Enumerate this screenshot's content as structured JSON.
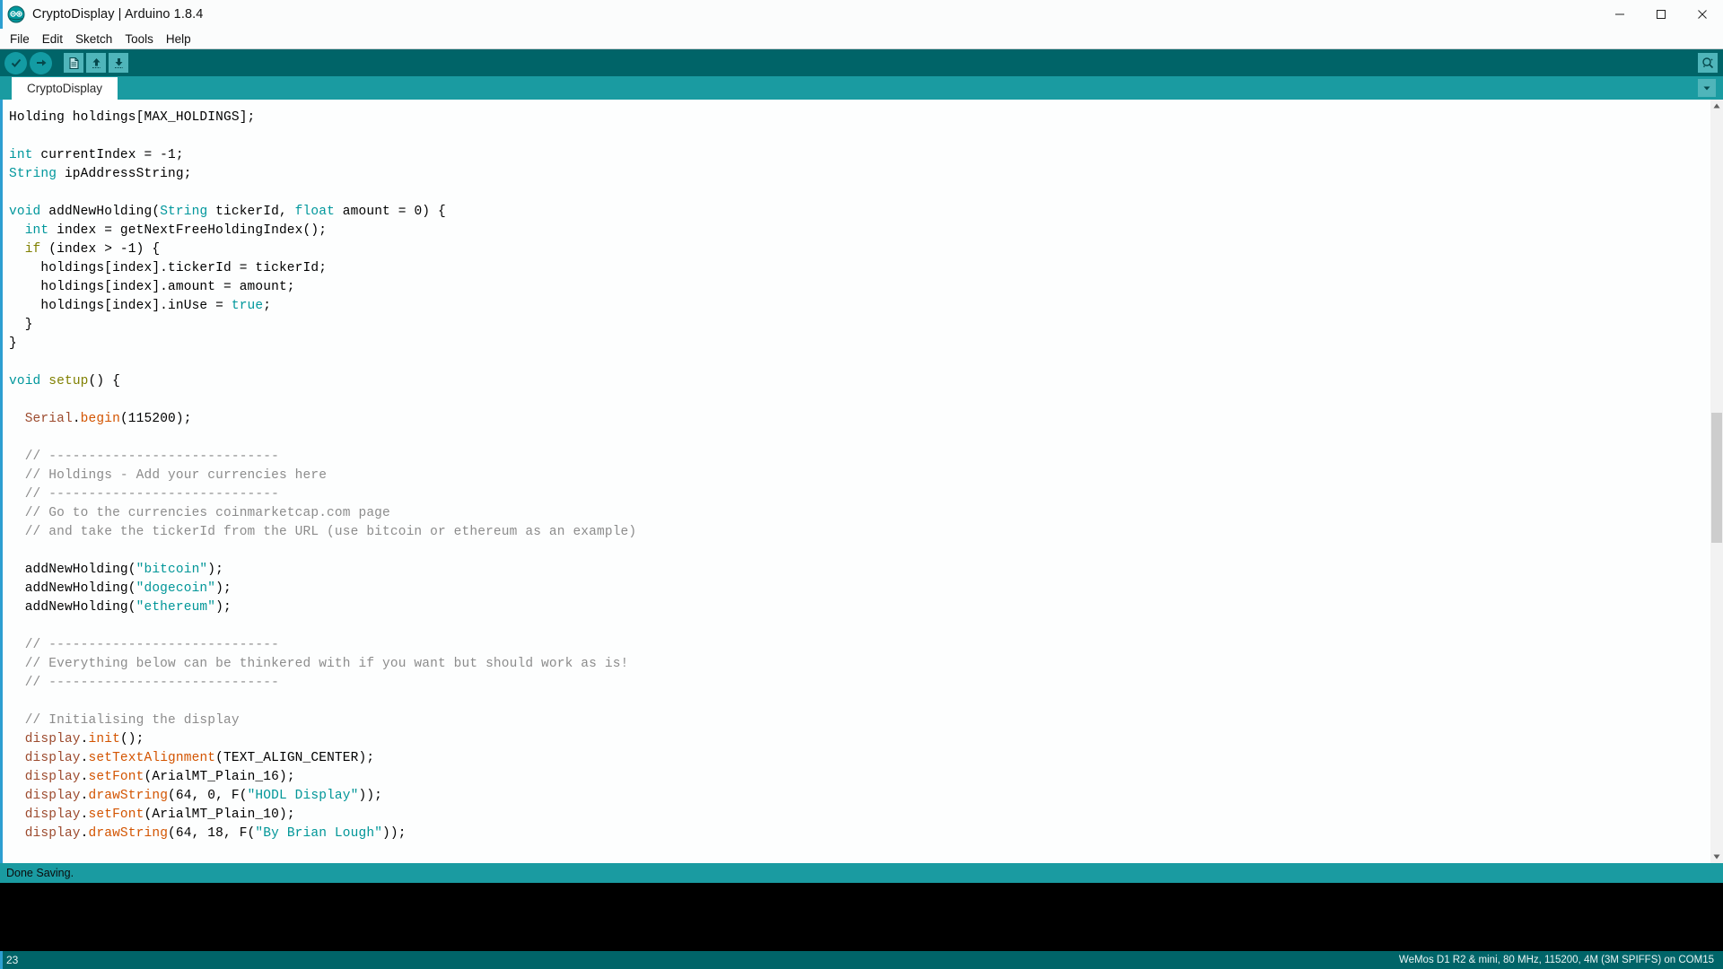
{
  "window": {
    "title": "CryptoDisplay | Arduino 1.8.4",
    "logo_icon": "arduino-logo-icon",
    "minimize_label": "─",
    "maximize_label": "☐",
    "close_label": "✕"
  },
  "menubar": {
    "items": [
      {
        "label": "File"
      },
      {
        "label": "Edit"
      },
      {
        "label": "Sketch"
      },
      {
        "label": "Tools"
      },
      {
        "label": "Help"
      }
    ]
  },
  "toolbar": {
    "verify_icon": "check-icon",
    "upload_icon": "arrow-right-icon",
    "new_icon": "new-file-icon",
    "open_icon": "arrow-up-icon",
    "save_icon": "arrow-down-icon",
    "serial_monitor_icon": "magnifier-icon"
  },
  "tabs": {
    "items": [
      {
        "label": "CryptoDisplay",
        "active": true
      }
    ],
    "menu_icon": "chevron-down-icon"
  },
  "editor": {
    "lines": [
      [
        {
          "t": "Holding holdings[MAX_HOLDINGS];",
          "c": ""
        }
      ],
      [
        {
          "t": "",
          "c": ""
        }
      ],
      [
        {
          "t": "int",
          "c": "kw"
        },
        {
          "t": " currentIndex = -1;",
          "c": ""
        }
      ],
      [
        {
          "t": "String",
          "c": "kw"
        },
        {
          "t": " ipAddressString;",
          "c": ""
        }
      ],
      [
        {
          "t": "",
          "c": ""
        }
      ],
      [
        {
          "t": "void",
          "c": "kw"
        },
        {
          "t": " addNewHolding(",
          "c": ""
        },
        {
          "t": "String",
          "c": "kw"
        },
        {
          "t": " tickerId, ",
          "c": ""
        },
        {
          "t": "float",
          "c": "kw"
        },
        {
          "t": " amount = 0) {",
          "c": ""
        }
      ],
      [
        {
          "t": "  ",
          "c": ""
        },
        {
          "t": "int",
          "c": "kw"
        },
        {
          "t": " index = getNextFreeHoldingIndex();",
          "c": ""
        }
      ],
      [
        {
          "t": "  ",
          "c": ""
        },
        {
          "t": "if",
          "c": "fn"
        },
        {
          "t": " (index > -1) {",
          "c": ""
        }
      ],
      [
        {
          "t": "    holdings[index].tickerId = tickerId;",
          "c": ""
        }
      ],
      [
        {
          "t": "    holdings[index].amount = amount;",
          "c": ""
        }
      ],
      [
        {
          "t": "    holdings[index].inUse = ",
          "c": ""
        },
        {
          "t": "true",
          "c": "kw"
        },
        {
          "t": ";",
          "c": ""
        }
      ],
      [
        {
          "t": "  }",
          "c": ""
        }
      ],
      [
        {
          "t": "}",
          "c": ""
        }
      ],
      [
        {
          "t": "",
          "c": ""
        }
      ],
      [
        {
          "t": "void",
          "c": "kw"
        },
        {
          "t": " ",
          "c": ""
        },
        {
          "t": "setup",
          "c": "fn"
        },
        {
          "t": "() {",
          "c": ""
        }
      ],
      [
        {
          "t": "",
          "c": ""
        }
      ],
      [
        {
          "t": "  ",
          "c": ""
        },
        {
          "t": "Serial",
          "c": "obj"
        },
        {
          "t": ".",
          "c": ""
        },
        {
          "t": "begin",
          "c": "mth"
        },
        {
          "t": "(115200);",
          "c": ""
        }
      ],
      [
        {
          "t": "",
          "c": ""
        }
      ],
      [
        {
          "t": "  // -----------------------------",
          "c": "cmt"
        }
      ],
      [
        {
          "t": "  // Holdings - Add your currencies here",
          "c": "cmt"
        }
      ],
      [
        {
          "t": "  // -----------------------------",
          "c": "cmt"
        }
      ],
      [
        {
          "t": "  // Go to the currencies coinmarketcap.com page",
          "c": "cmt"
        }
      ],
      [
        {
          "t": "  // and take the tickerId from the URL (use bitcoin or ethereum as an example)",
          "c": "cmt"
        }
      ],
      [
        {
          "t": "",
          "c": ""
        }
      ],
      [
        {
          "t": "  addNewHolding(",
          "c": ""
        },
        {
          "t": "\"bitcoin\"",
          "c": "str"
        },
        {
          "t": ");",
          "c": ""
        }
      ],
      [
        {
          "t": "  addNewHolding(",
          "c": ""
        },
        {
          "t": "\"dogecoin\"",
          "c": "str"
        },
        {
          "t": ");",
          "c": ""
        }
      ],
      [
        {
          "t": "  addNewHolding(",
          "c": ""
        },
        {
          "t": "\"ethereum\"",
          "c": "str"
        },
        {
          "t": ");",
          "c": ""
        }
      ],
      [
        {
          "t": "",
          "c": ""
        }
      ],
      [
        {
          "t": "  // -----------------------------",
          "c": "cmt"
        }
      ],
      [
        {
          "t": "  // Everything below can be thinkered with if you want but should work as is!",
          "c": "cmt"
        }
      ],
      [
        {
          "t": "  // -----------------------------",
          "c": "cmt"
        }
      ],
      [
        {
          "t": "",
          "c": ""
        }
      ],
      [
        {
          "t": "  // Initialising the display",
          "c": "cmt"
        }
      ],
      [
        {
          "t": "  ",
          "c": ""
        },
        {
          "t": "display",
          "c": "obj"
        },
        {
          "t": ".",
          "c": ""
        },
        {
          "t": "init",
          "c": "mth"
        },
        {
          "t": "();",
          "c": ""
        }
      ],
      [
        {
          "t": "  ",
          "c": ""
        },
        {
          "t": "display",
          "c": "obj"
        },
        {
          "t": ".",
          "c": ""
        },
        {
          "t": "setTextAlignment",
          "c": "mth"
        },
        {
          "t": "(TEXT_ALIGN_CENTER);",
          "c": ""
        }
      ],
      [
        {
          "t": "  ",
          "c": ""
        },
        {
          "t": "display",
          "c": "obj"
        },
        {
          "t": ".",
          "c": ""
        },
        {
          "t": "setFont",
          "c": "mth"
        },
        {
          "t": "(ArialMT_Plain_16);",
          "c": ""
        }
      ],
      [
        {
          "t": "  ",
          "c": ""
        },
        {
          "t": "display",
          "c": "obj"
        },
        {
          "t": ".",
          "c": ""
        },
        {
          "t": "drawString",
          "c": "mth"
        },
        {
          "t": "(64, 0, F(",
          "c": ""
        },
        {
          "t": "\"HODL Display\"",
          "c": "str"
        },
        {
          "t": "));",
          "c": ""
        }
      ],
      [
        {
          "t": "  ",
          "c": ""
        },
        {
          "t": "display",
          "c": "obj"
        },
        {
          "t": ".",
          "c": ""
        },
        {
          "t": "setFont",
          "c": "mth"
        },
        {
          "t": "(ArialMT_Plain_10);",
          "c": ""
        }
      ],
      [
        {
          "t": "  ",
          "c": ""
        },
        {
          "t": "display",
          "c": "obj"
        },
        {
          "t": ".",
          "c": ""
        },
        {
          "t": "drawString",
          "c": "mth"
        },
        {
          "t": "(64, 18, F(",
          "c": ""
        },
        {
          "t": "\"By Brian Lough\"",
          "c": "str"
        },
        {
          "t": "));",
          "c": ""
        }
      ]
    ],
    "scrollbar": {
      "up_icon": "caret-up-icon",
      "down_icon": "caret-down-icon"
    }
  },
  "status": {
    "message": "Done Saving.",
    "console_text": ""
  },
  "bottombar": {
    "line_number": "23",
    "board_info": "WeMos D1 R2 & mini, 80 MHz, 115200, 4M (3M SPIFFS) on COM15"
  },
  "colors": {
    "toolbar_bg": "#006468",
    "tabbar_bg": "#1a9ba1",
    "accent": "#2d9fd1",
    "keyword": "#00979c",
    "function": "#808000",
    "object": "#9c4a2d",
    "method": "#d35400",
    "string": "#009698",
    "comment": "#8c8c8c"
  }
}
